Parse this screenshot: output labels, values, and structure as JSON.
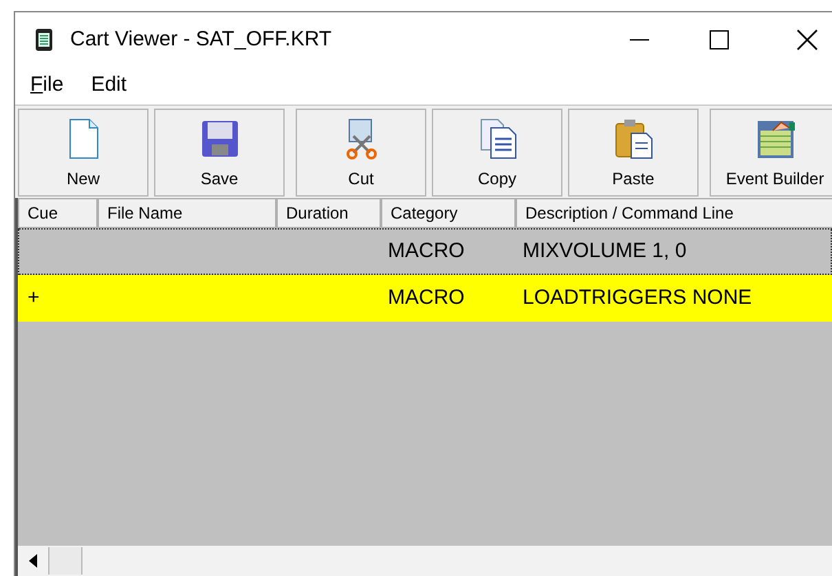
{
  "window": {
    "title": "Cart Viewer - SAT_OFF.KRT"
  },
  "menu": [
    {
      "label": "File",
      "underline_first": true
    },
    {
      "label": "Edit",
      "underline_first": false
    }
  ],
  "toolbar": [
    {
      "label": "New",
      "kind": "new"
    },
    {
      "label": "Save",
      "kind": "save"
    },
    {
      "kind": "separator"
    },
    {
      "label": "Cut",
      "kind": "cut"
    },
    {
      "label": "Copy",
      "kind": "copy"
    },
    {
      "label": "Paste",
      "kind": "paste"
    },
    {
      "kind": "separator"
    },
    {
      "label": "Event Builder",
      "kind": "event"
    }
  ],
  "table": {
    "columns": [
      "Cue",
      "File Name",
      "Duration",
      "Category",
      "Description / Command Line"
    ],
    "rows": [
      {
        "cells": [
          "",
          "",
          "",
          "MACRO",
          "MIXVOLUME 1, 0"
        ],
        "selected": true,
        "color": "#c0c0c0"
      },
      {
        "cells": [
          "+",
          "",
          "",
          "MACRO",
          "LOADTRIGGERS NONE"
        ],
        "selected": false,
        "color": "#ffff00"
      }
    ]
  }
}
